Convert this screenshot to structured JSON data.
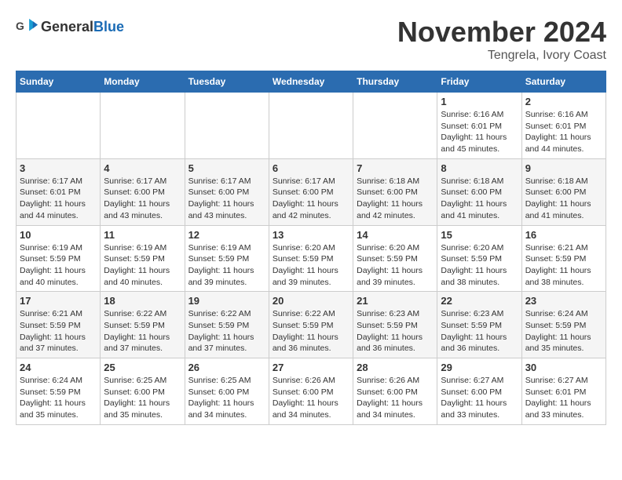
{
  "header": {
    "logo_general": "General",
    "logo_blue": "Blue",
    "month_year": "November 2024",
    "location": "Tengrela, Ivory Coast"
  },
  "weekdays": [
    "Sunday",
    "Monday",
    "Tuesday",
    "Wednesday",
    "Thursday",
    "Friday",
    "Saturday"
  ],
  "weeks": [
    [
      {
        "day": "",
        "info": ""
      },
      {
        "day": "",
        "info": ""
      },
      {
        "day": "",
        "info": ""
      },
      {
        "day": "",
        "info": ""
      },
      {
        "day": "",
        "info": ""
      },
      {
        "day": "1",
        "info": "Sunrise: 6:16 AM\nSunset: 6:01 PM\nDaylight: 11 hours and 45 minutes."
      },
      {
        "day": "2",
        "info": "Sunrise: 6:16 AM\nSunset: 6:01 PM\nDaylight: 11 hours and 44 minutes."
      }
    ],
    [
      {
        "day": "3",
        "info": "Sunrise: 6:17 AM\nSunset: 6:01 PM\nDaylight: 11 hours and 44 minutes."
      },
      {
        "day": "4",
        "info": "Sunrise: 6:17 AM\nSunset: 6:00 PM\nDaylight: 11 hours and 43 minutes."
      },
      {
        "day": "5",
        "info": "Sunrise: 6:17 AM\nSunset: 6:00 PM\nDaylight: 11 hours and 43 minutes."
      },
      {
        "day": "6",
        "info": "Sunrise: 6:17 AM\nSunset: 6:00 PM\nDaylight: 11 hours and 42 minutes."
      },
      {
        "day": "7",
        "info": "Sunrise: 6:18 AM\nSunset: 6:00 PM\nDaylight: 11 hours and 42 minutes."
      },
      {
        "day": "8",
        "info": "Sunrise: 6:18 AM\nSunset: 6:00 PM\nDaylight: 11 hours and 41 minutes."
      },
      {
        "day": "9",
        "info": "Sunrise: 6:18 AM\nSunset: 6:00 PM\nDaylight: 11 hours and 41 minutes."
      }
    ],
    [
      {
        "day": "10",
        "info": "Sunrise: 6:19 AM\nSunset: 5:59 PM\nDaylight: 11 hours and 40 minutes."
      },
      {
        "day": "11",
        "info": "Sunrise: 6:19 AM\nSunset: 5:59 PM\nDaylight: 11 hours and 40 minutes."
      },
      {
        "day": "12",
        "info": "Sunrise: 6:19 AM\nSunset: 5:59 PM\nDaylight: 11 hours and 39 minutes."
      },
      {
        "day": "13",
        "info": "Sunrise: 6:20 AM\nSunset: 5:59 PM\nDaylight: 11 hours and 39 minutes."
      },
      {
        "day": "14",
        "info": "Sunrise: 6:20 AM\nSunset: 5:59 PM\nDaylight: 11 hours and 39 minutes."
      },
      {
        "day": "15",
        "info": "Sunrise: 6:20 AM\nSunset: 5:59 PM\nDaylight: 11 hours and 38 minutes."
      },
      {
        "day": "16",
        "info": "Sunrise: 6:21 AM\nSunset: 5:59 PM\nDaylight: 11 hours and 38 minutes."
      }
    ],
    [
      {
        "day": "17",
        "info": "Sunrise: 6:21 AM\nSunset: 5:59 PM\nDaylight: 11 hours and 37 minutes."
      },
      {
        "day": "18",
        "info": "Sunrise: 6:22 AM\nSunset: 5:59 PM\nDaylight: 11 hours and 37 minutes."
      },
      {
        "day": "19",
        "info": "Sunrise: 6:22 AM\nSunset: 5:59 PM\nDaylight: 11 hours and 37 minutes."
      },
      {
        "day": "20",
        "info": "Sunrise: 6:22 AM\nSunset: 5:59 PM\nDaylight: 11 hours and 36 minutes."
      },
      {
        "day": "21",
        "info": "Sunrise: 6:23 AM\nSunset: 5:59 PM\nDaylight: 11 hours and 36 minutes."
      },
      {
        "day": "22",
        "info": "Sunrise: 6:23 AM\nSunset: 5:59 PM\nDaylight: 11 hours and 36 minutes."
      },
      {
        "day": "23",
        "info": "Sunrise: 6:24 AM\nSunset: 5:59 PM\nDaylight: 11 hours and 35 minutes."
      }
    ],
    [
      {
        "day": "24",
        "info": "Sunrise: 6:24 AM\nSunset: 5:59 PM\nDaylight: 11 hours and 35 minutes."
      },
      {
        "day": "25",
        "info": "Sunrise: 6:25 AM\nSunset: 6:00 PM\nDaylight: 11 hours and 35 minutes."
      },
      {
        "day": "26",
        "info": "Sunrise: 6:25 AM\nSunset: 6:00 PM\nDaylight: 11 hours and 34 minutes."
      },
      {
        "day": "27",
        "info": "Sunrise: 6:26 AM\nSunset: 6:00 PM\nDaylight: 11 hours and 34 minutes."
      },
      {
        "day": "28",
        "info": "Sunrise: 6:26 AM\nSunset: 6:00 PM\nDaylight: 11 hours and 34 minutes."
      },
      {
        "day": "29",
        "info": "Sunrise: 6:27 AM\nSunset: 6:00 PM\nDaylight: 11 hours and 33 minutes."
      },
      {
        "day": "30",
        "info": "Sunrise: 6:27 AM\nSunset: 6:01 PM\nDaylight: 11 hours and 33 minutes."
      }
    ]
  ]
}
